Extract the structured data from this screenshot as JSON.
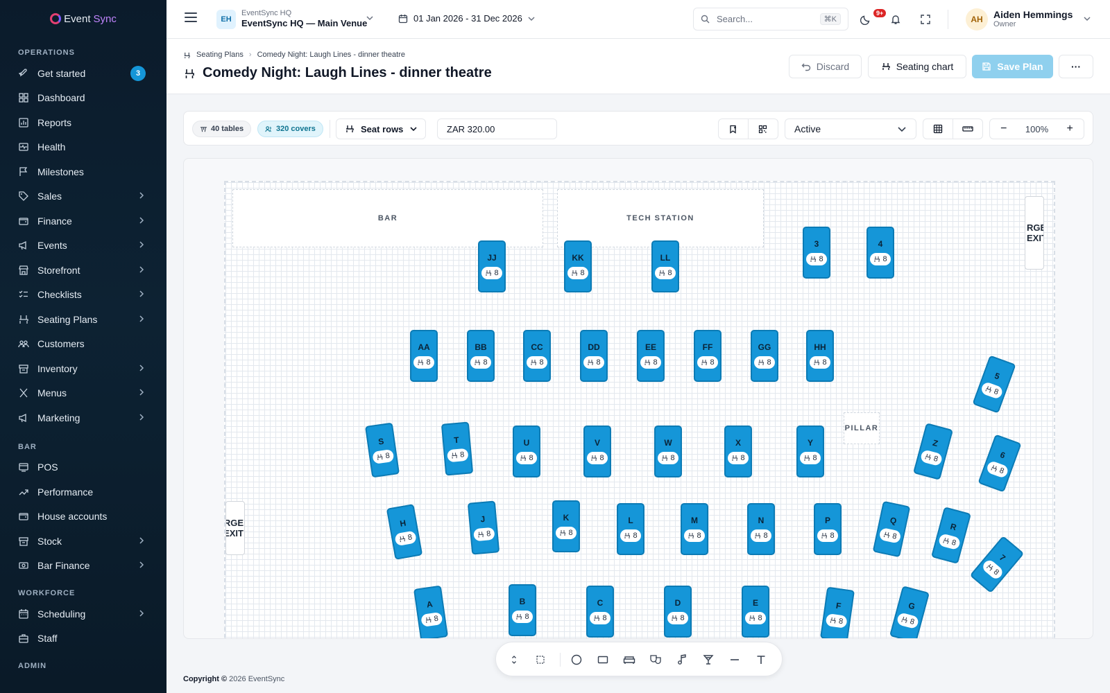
{
  "app": {
    "brand_prefix": "Event",
    "brand_suffix": "Sync"
  },
  "sidebar": {
    "sections": [
      {
        "label": "OPERATIONS",
        "items": [
          {
            "label": "Get started",
            "icon": "rocket-icon",
            "badge": "3"
          },
          {
            "label": "Dashboard",
            "icon": "dashboard-icon"
          },
          {
            "label": "Reports",
            "icon": "reports-icon"
          },
          {
            "label": "Health",
            "icon": "health-icon"
          },
          {
            "label": "Milestones",
            "icon": "flag-icon"
          },
          {
            "label": "Sales",
            "icon": "tag-icon",
            "chevron": true
          },
          {
            "label": "Finance",
            "icon": "wallet-icon",
            "chevron": true
          },
          {
            "label": "Events",
            "icon": "megaphone-icon",
            "chevron": true
          },
          {
            "label": "Storefront",
            "icon": "storefront-icon",
            "chevron": true
          },
          {
            "label": "Checklists",
            "icon": "checklist-icon",
            "chevron": true
          },
          {
            "label": "Seating Plans",
            "icon": "chair-icon",
            "chevron": true
          },
          {
            "label": "Customers",
            "icon": "users-icon"
          },
          {
            "label": "Inventory",
            "icon": "box-icon",
            "chevron": true
          },
          {
            "label": "Menus",
            "icon": "utensils-icon",
            "chevron": true
          },
          {
            "label": "Marketing",
            "icon": "megaphone-icon",
            "chevron": true
          }
        ]
      },
      {
        "label": "BAR",
        "items": [
          {
            "label": "POS",
            "icon": "pos-icon"
          },
          {
            "label": "Performance",
            "icon": "trend-icon"
          },
          {
            "label": "House accounts",
            "icon": "wallet-icon"
          },
          {
            "label": "Stock",
            "icon": "box-icon",
            "chevron": true
          },
          {
            "label": "Bar Finance",
            "icon": "cash-icon",
            "chevron": true
          }
        ]
      },
      {
        "label": "WORKFORCE",
        "items": [
          {
            "label": "Scheduling",
            "icon": "calendar-icon",
            "chevron": true
          },
          {
            "label": "Staff",
            "icon": "briefcase-icon"
          }
        ]
      },
      {
        "label": "ADMIN",
        "items": []
      }
    ]
  },
  "topbar": {
    "venue_initials": "EH",
    "venue_org": "EventSync HQ",
    "venue_name": "EventSync HQ — Main Venue",
    "date_range": "01 Jan 2026 - 31 Dec 2026",
    "search_placeholder": "Search...",
    "search_shortcut": "⌘K",
    "notif_count": "9+",
    "user_initials": "AH",
    "user_name": "Aiden Hemmings",
    "user_role": "Owner"
  },
  "header": {
    "breadcrumb_parent": "Seating Plans",
    "breadcrumb_current": "Comedy Night: Laugh Lines - dinner theatre",
    "title": "Comedy Night: Laugh Lines - dinner theatre",
    "discard_label": "Discard",
    "seating_chart_label": "Seating chart",
    "save_label": "Save Plan",
    "more_label": "···"
  },
  "toolbar": {
    "tables_pill": "40 tables",
    "covers_pill": "320 covers",
    "seat_rows_label": "Seat rows",
    "price_value": "ZAR 320.00",
    "status_value": "Active",
    "zoom_value": "100%"
  },
  "canvas": {
    "zones": {
      "bar": "BAR",
      "tech": "TECH STATION",
      "pillar": "PILLAR"
    },
    "exit_right": [
      "RGE",
      "EXIT"
    ],
    "exit_left": [
      "RGE",
      "EXIT"
    ],
    "seats_per_table": "8",
    "tables": [
      {
        "label": "JJ"
      },
      {
        "label": "KK"
      },
      {
        "label": "LL"
      },
      {
        "label": "3"
      },
      {
        "label": "4"
      },
      {
        "label": "AA"
      },
      {
        "label": "BB"
      },
      {
        "label": "CC"
      },
      {
        "label": "DD"
      },
      {
        "label": "EE"
      },
      {
        "label": "FF"
      },
      {
        "label": "GG"
      },
      {
        "label": "HH"
      },
      {
        "label": "5"
      },
      {
        "label": "S"
      },
      {
        "label": "T"
      },
      {
        "label": "U"
      },
      {
        "label": "V"
      },
      {
        "label": "W"
      },
      {
        "label": "X"
      },
      {
        "label": "Y"
      },
      {
        "label": "Z"
      },
      {
        "label": "6"
      },
      {
        "label": "H"
      },
      {
        "label": "J"
      },
      {
        "label": "K"
      },
      {
        "label": "L"
      },
      {
        "label": "M"
      },
      {
        "label": "N"
      },
      {
        "label": "P"
      },
      {
        "label": "Q"
      },
      {
        "label": "R"
      },
      {
        "label": "7"
      },
      {
        "label": "A"
      },
      {
        "label": "B"
      },
      {
        "label": "C"
      },
      {
        "label": "D"
      },
      {
        "label": "E"
      },
      {
        "label": "F"
      },
      {
        "label": "G"
      }
    ]
  },
  "footer": {
    "copyright": "Copyright ©",
    "year_brand": "2026 EventSync"
  }
}
